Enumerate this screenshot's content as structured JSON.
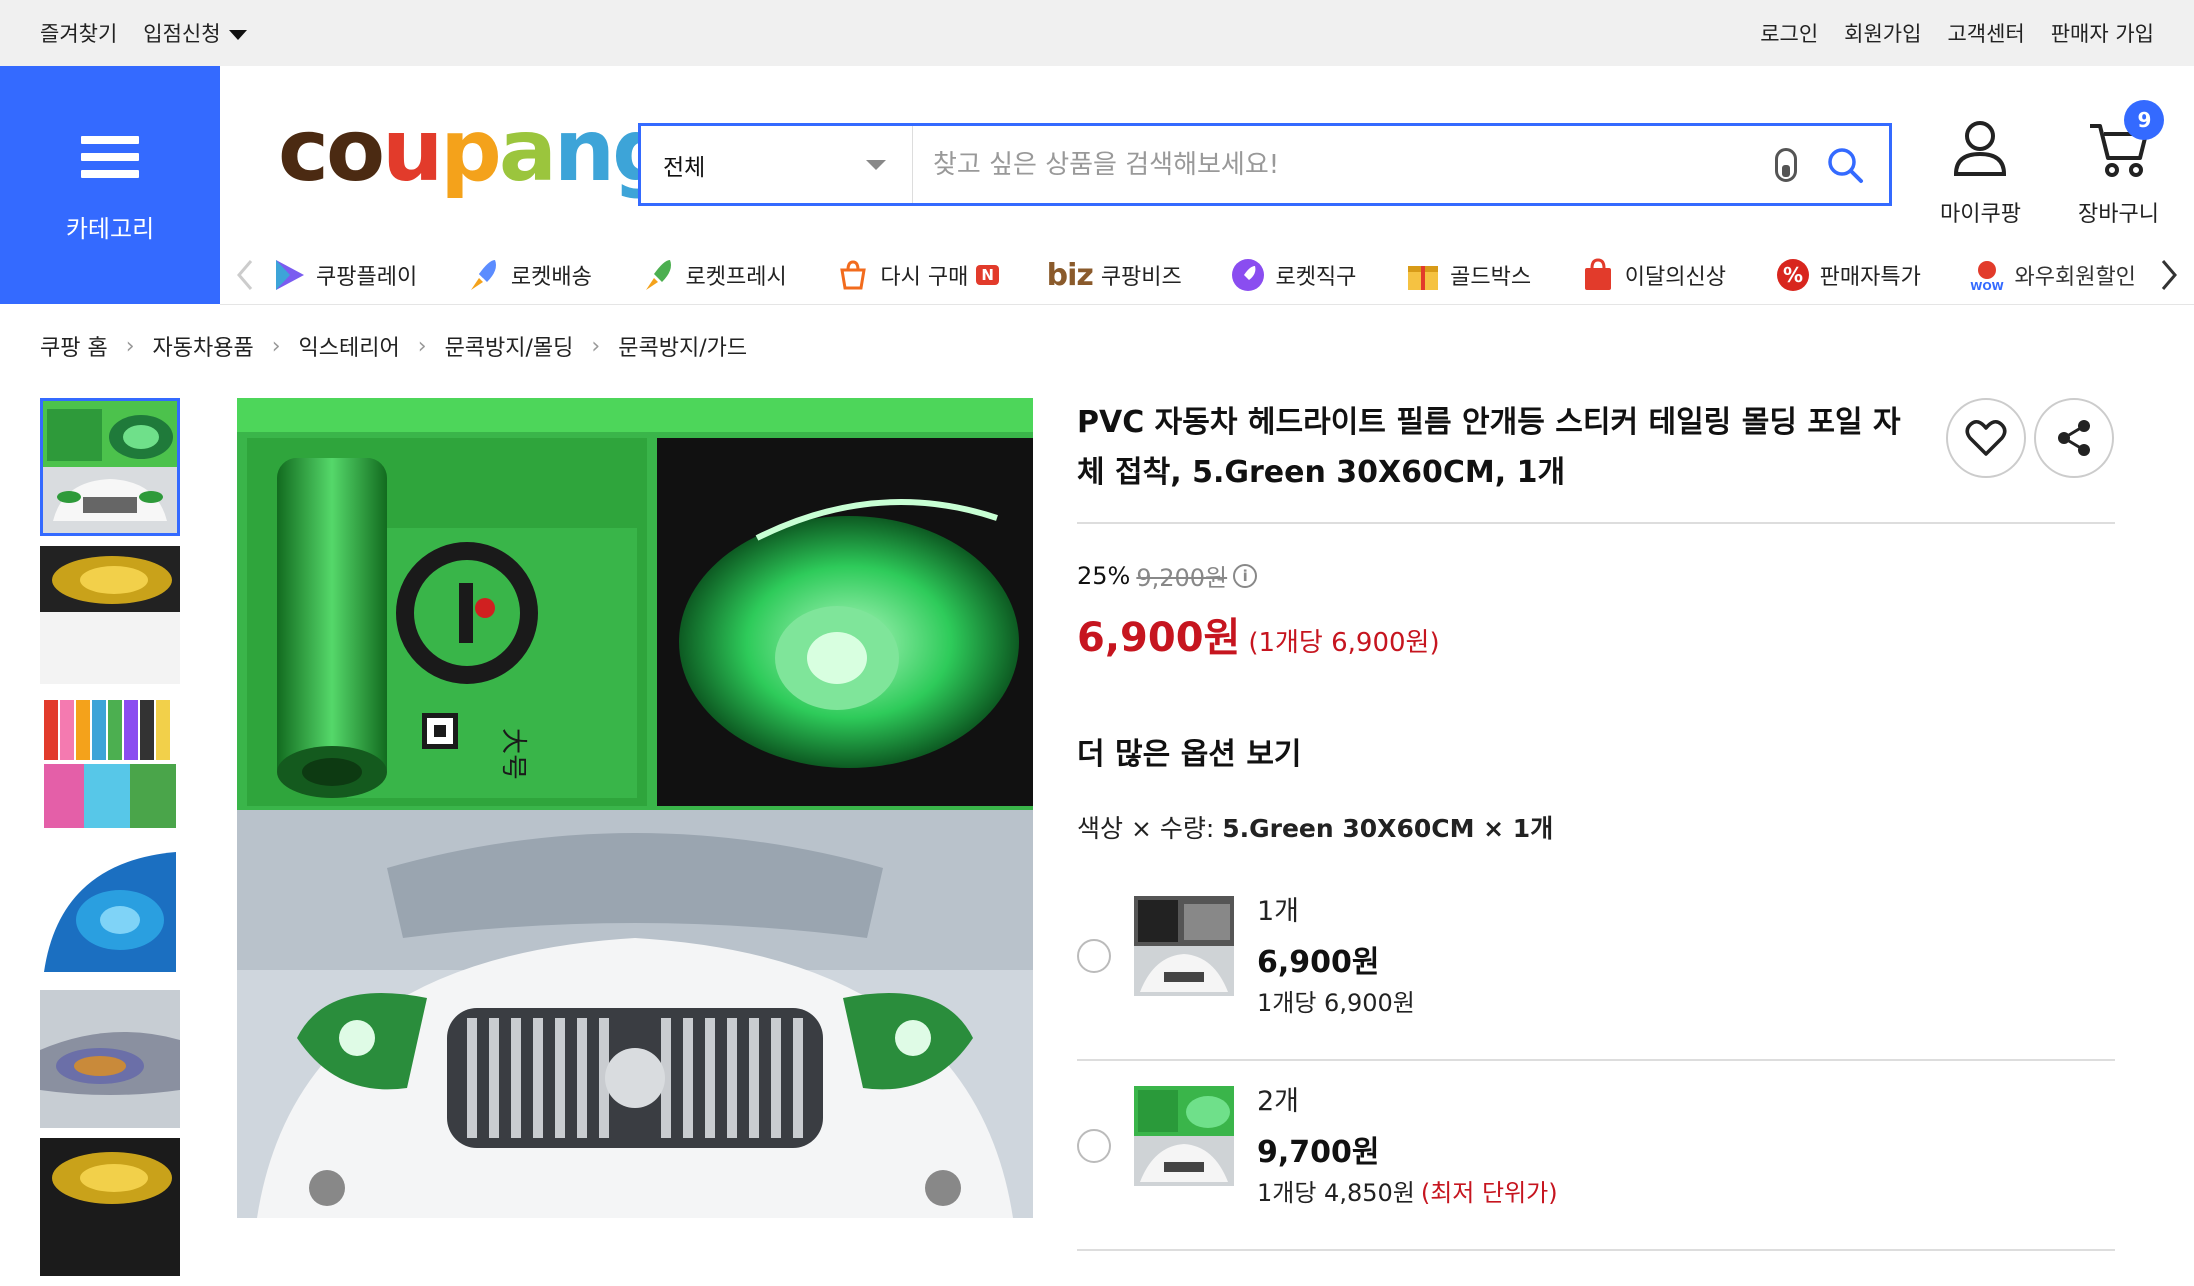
{
  "topbar": {
    "bookmark": "즐겨찾기",
    "apply": "입점신청",
    "login": "로그인",
    "signup": "회원가입",
    "support": "고객센터",
    "seller": "판매자 가입"
  },
  "header": {
    "category_label": "카테고리",
    "logo_text": "coupang",
    "search_category": "전체",
    "search_placeholder": "찾고 싶은 상품을 검색해보세요!",
    "mycoupang": "마이쿠팡",
    "cart": "장바구니",
    "cart_count": "9"
  },
  "nav": {
    "items": [
      {
        "label": "쿠팡플레이",
        "icon": "play-icon"
      },
      {
        "label": "로켓배송",
        "icon": "rocket-icon"
      },
      {
        "label": "로켓프레시",
        "icon": "rocket-fresh-icon"
      },
      {
        "label": "다시 구매",
        "icon": "repurchase-icon",
        "badge": "N"
      },
      {
        "label": "쿠팡비즈",
        "icon": "biz-icon",
        "prefix": "biz"
      },
      {
        "label": "로켓직구",
        "icon": "rocket-global-icon"
      },
      {
        "label": "골드박스",
        "icon": "goldbox-icon"
      },
      {
        "label": "이달의신상",
        "icon": "new-bag-icon"
      },
      {
        "label": "판매자특가",
        "icon": "percent-icon"
      },
      {
        "label": "와우회원할인",
        "icon": "wow-icon"
      }
    ]
  },
  "breadcrumb": [
    "쿠팡 홈",
    "자동차용품",
    "익스테리어",
    "문콕방지/몰딩",
    "문콕방지/가드"
  ],
  "product": {
    "title": "PVC 자동차 헤드라이트 필름 안개등 스티커 테일링 몰딩 포일 자체 접착, 5.Green 30X60CM, 1개",
    "discount_rate": "25%",
    "original_price": "9,200원",
    "sale_price": "6,900원",
    "unit_price": "(1개당 6,900원)",
    "more_options": "더 많은 옵션 보기",
    "option_label": "색상 × 수량:",
    "option_value": "5.Green 30X60CM × 1개",
    "options": [
      {
        "qty": "1개",
        "price": "6,900원",
        "unit": "1개당 6,900원",
        "note": ""
      },
      {
        "qty": "2개",
        "price": "9,700원",
        "unit": "1개당 4,850원",
        "note": "(최저 단위가)"
      }
    ]
  },
  "colors": {
    "brand_blue": "#346aff",
    "price_red": "#c6151f"
  }
}
